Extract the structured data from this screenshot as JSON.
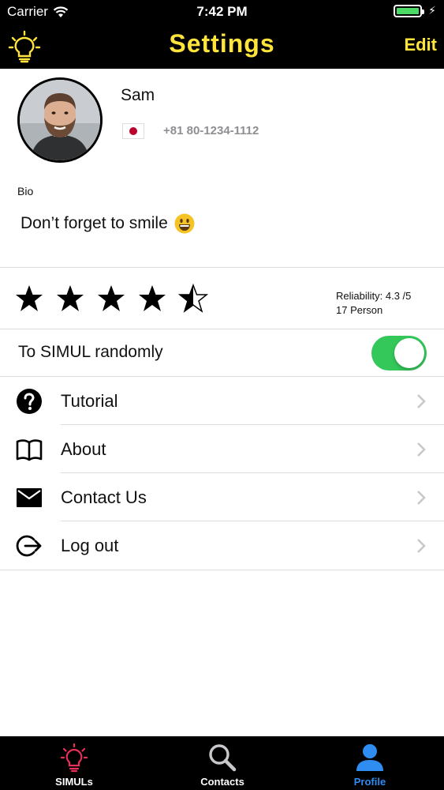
{
  "status_bar": {
    "carrier": "Carrier",
    "time": "7:42 PM"
  },
  "nav": {
    "title": "Settings",
    "edit_label": "Edit"
  },
  "profile": {
    "name": "Sam",
    "phone": "+81 80-1234-1112",
    "bio_label": "Bio",
    "bio_text": "Don’t forget to smile"
  },
  "rating": {
    "value": 4.3,
    "max": 5,
    "reliability_text": "Reliability: 4.3 /5",
    "persons_text": "17 Person"
  },
  "toggle": {
    "label": "To SIMUL randomly",
    "on": true
  },
  "menu": [
    {
      "label": "Tutorial",
      "icon": "question-circle-icon"
    },
    {
      "label": "About",
      "icon": "book-icon"
    },
    {
      "label": "Contact Us",
      "icon": "envelope-icon"
    },
    {
      "label": "Log out",
      "icon": "logout-icon"
    }
  ],
  "tabs": [
    {
      "label": "SIMULs",
      "icon": "lightbulb-icon",
      "active": false
    },
    {
      "label": "Contacts",
      "icon": "search-icon",
      "active": false
    },
    {
      "label": "Profile",
      "icon": "person-icon",
      "active": true
    }
  ],
  "colors": {
    "accent_yellow": "#ffe53b",
    "toggle_green": "#34c759",
    "tab_active_blue": "#2f8cf0",
    "simul_tab_red": "#e8305a",
    "battery_green": "#4cd964"
  }
}
